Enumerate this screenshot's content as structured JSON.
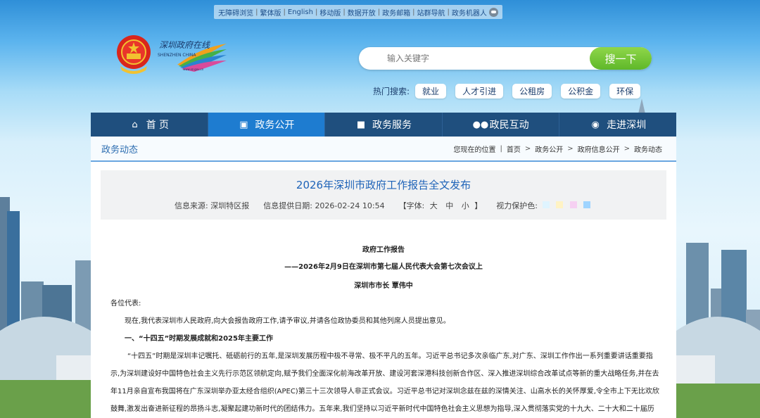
{
  "top_links": [
    "无障碍浏览",
    "繁体版",
    "English",
    "移动版",
    "数据开放",
    "政务邮箱",
    "站群导航",
    "政务机器人"
  ],
  "logo": {
    "title": "深圳政府在线",
    "subtitle": "SHENZHEN CHINA",
    "url": "www.sz.gov.cn"
  },
  "search": {
    "placeholder": "输入关键字",
    "button": "搜一下"
  },
  "hot": {
    "label": "热门搜索:",
    "tags": [
      "就业",
      "人才引进",
      "公租房",
      "公积金",
      "环保"
    ]
  },
  "nav": [
    {
      "label": "首 页",
      "icon": "home-icon"
    },
    {
      "label": "政务公开",
      "icon": "government-icon"
    },
    {
      "label": "政务服务",
      "icon": "service-icon"
    },
    {
      "label": "政民互动",
      "icon": "people-icon"
    },
    {
      "label": "走进深圳",
      "icon": "info-icon"
    }
  ],
  "section_title": "政务动态",
  "breadcrumb": [
    "您现在的位置",
    "首页",
    "政务公开",
    "政府信息公开",
    "政务动态"
  ],
  "article": {
    "title": "2026年深圳市政府工作报告全文发布",
    "source_label": "信息来源:",
    "source": "深圳特区报",
    "date_label": "信息提供日期:",
    "date": "2026-02-24 10:54",
    "font_label": "【字体:",
    "font_sizes": [
      "大",
      "中",
      "小"
    ],
    "font_close": "】",
    "eye_label": "视力保护色:",
    "eye_colors": [
      "#dff4ff",
      "#fff3c4",
      "#f6d0f2",
      "#9fd4ff"
    ],
    "heading": "政府工作报告",
    "subheading": "——2026年2月9日在深圳市第七届人民代表大会第七次会议上",
    "speaker": "深圳市市长 覃伟中",
    "greeting": "各位代表:",
    "para1": "现在,我代表深圳市人民政府,向大会报告政府工作,请予审议,并请各位政协委员和其他列席人员提出意见。",
    "section1": "一、“十四五”时期发展成就和2025年主要工作",
    "para2_1": "“十四五”时期是深圳丰记嘱托、砥砺前行的五年,是深圳发展历程中极不寻常、极不平凡的五年。习近平总书记多次亲临广东,对广东、深圳工作作出一系列重要讲话重要指",
    "para2_2": "示,为深圳建设好中国特色社会主义先行示范区领航定向,赋予我们全面深化前海改革开放、建设河套深港科技创新合作区、深入推进深圳综合改革试点等新的重大战略任务,并在去",
    "para2_3": "年11月亲自宣布我国将在广东深圳举办亚太经合组织(APEC)第三十三次领导人非正式会议。习近平总书记对深圳念兹在兹的深情关注、山高水长的关怀厚爱,令全市上下无比欢欣",
    "para2_4": "鼓舞,激发出奋进新征程的昂扬斗志,凝聚起建功新时代的团结伟力。五年来,我们坚持以习近平新时代中国特色社会主义思想为指导,深入贯彻落实党的十九大、二十大和二十届历"
  }
}
